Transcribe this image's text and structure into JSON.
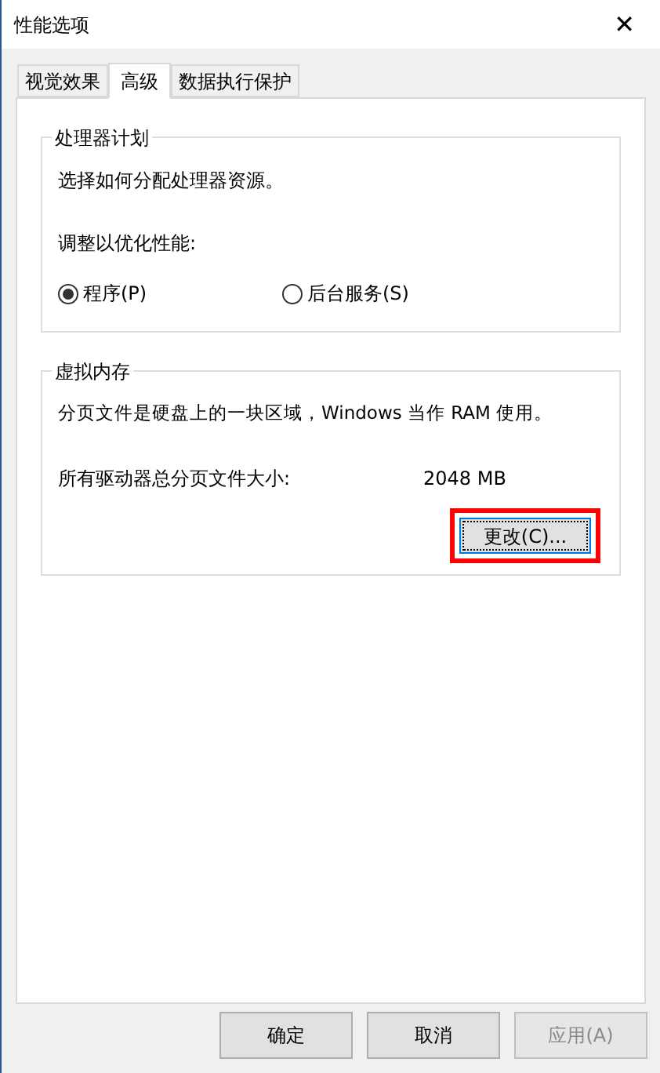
{
  "window": {
    "title": "性能选项",
    "close": "✕"
  },
  "tabs": [
    {
      "label": "视觉效果",
      "selected": false
    },
    {
      "label": "高级",
      "selected": true
    },
    {
      "label": "数据执行保护",
      "selected": false
    }
  ],
  "processor_group": {
    "title": "处理器计划",
    "description": "选择如何分配处理器资源。",
    "adjust_label": "调整以优化性能:",
    "options": [
      {
        "label": "程序(P)",
        "selected": true
      },
      {
        "label": "后台服务(S)",
        "selected": false
      }
    ]
  },
  "virtual_memory_group": {
    "title": "虚拟内存",
    "description": "分页文件是硬盘上的一块区域，Windows 当作 RAM 使用。",
    "size_label": "所有驱动器总分页文件大小:",
    "size_value": "2048 MB",
    "change_button": {
      "label": "更改(C)...",
      "highlighted": true
    }
  },
  "buttons": [
    {
      "label": "确定",
      "disabled": false
    },
    {
      "label": "取消",
      "disabled": false
    },
    {
      "label": "应用(A)",
      "disabled": true
    }
  ]
}
